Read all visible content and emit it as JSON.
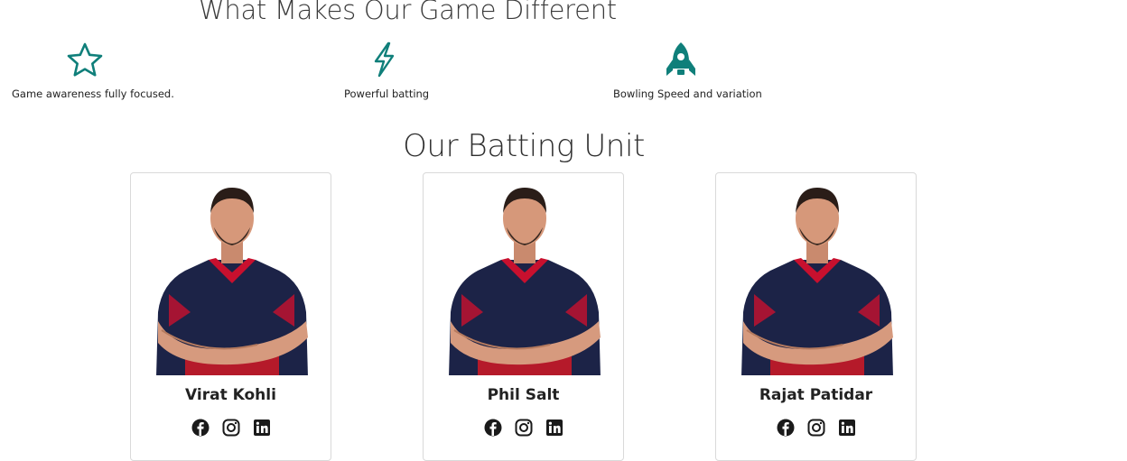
{
  "features": {
    "title": "What Makes Our Game Different",
    "items": [
      {
        "label": "Game awareness fully focused.",
        "icon": "star-icon"
      },
      {
        "label": "Powerful batting",
        "icon": "lightning-icon"
      },
      {
        "label": "Bowling Speed and variation",
        "icon": "rocket-icon"
      }
    ],
    "icon_color": "#0f7f7a"
  },
  "batting_unit": {
    "title": "Our Batting Unit",
    "players": [
      {
        "name": "Virat Kohli",
        "socials": [
          "facebook-icon",
          "instagram-icon",
          "linkedin-icon"
        ]
      },
      {
        "name": "Phil Salt",
        "socials": [
          "facebook-icon",
          "instagram-icon",
          "linkedin-icon"
        ]
      },
      {
        "name": "Rajat Patidar",
        "socials": [
          "facebook-icon",
          "instagram-icon",
          "linkedin-icon"
        ]
      }
    ]
  },
  "colors": {
    "jersey_navy": "#1c2347",
    "jersey_red": "#c8102e",
    "text": "#212529"
  }
}
